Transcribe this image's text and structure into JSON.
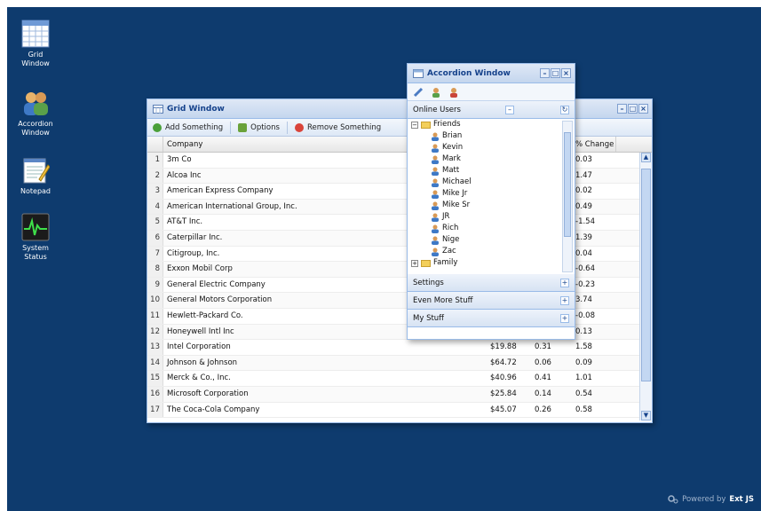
{
  "desktop_icons": [
    {
      "label_line1": "Grid",
      "label_line2": "Window",
      "icon": "grid-icon"
    },
    {
      "label_line1": "Accordion",
      "label_line2": "Window",
      "icon": "accordion-users-icon"
    },
    {
      "label_line1": "Notepad",
      "label_line2": "",
      "icon": "notepad-icon"
    },
    {
      "label_line1": "System",
      "label_line2": "Status",
      "icon": "system-status-icon"
    }
  ],
  "grid_window": {
    "title": "Grid Window",
    "toolbar": {
      "add": "Add Something",
      "options": "Options",
      "remove": "Remove Something"
    },
    "columns": {
      "company": "Company",
      "pct": "% Change"
    },
    "rows": [
      {
        "n": "1",
        "company": "3m Co",
        "price": "",
        "change": "",
        "pct": "0.03"
      },
      {
        "n": "2",
        "company": "Alcoa Inc",
        "price": "",
        "change": "",
        "pct": "1.47"
      },
      {
        "n": "3",
        "company": "American Express Company",
        "price": "",
        "change": "",
        "pct": "0.02"
      },
      {
        "n": "4",
        "company": "American International Group, Inc.",
        "price": "",
        "change": "",
        "pct": "0.49"
      },
      {
        "n": "5",
        "company": "AT&T Inc.",
        "price": "",
        "change": "",
        "pct": "-1.54"
      },
      {
        "n": "6",
        "company": "Caterpillar Inc.",
        "price": "",
        "change": "",
        "pct": "1.39"
      },
      {
        "n": "7",
        "company": "Citigroup, Inc.",
        "price": "",
        "change": "",
        "pct": "0.04"
      },
      {
        "n": "8",
        "company": "Exxon Mobil Corp",
        "price": "",
        "change": "",
        "pct": "-0.64"
      },
      {
        "n": "9",
        "company": "General Electric Company",
        "price": "",
        "change": "",
        "pct": "-0.23"
      },
      {
        "n": "10",
        "company": "General Motors Corporation",
        "price": "",
        "change": "",
        "pct": "3.74"
      },
      {
        "n": "11",
        "company": "Hewlett-Packard Co.",
        "price": "",
        "change": "",
        "pct": "-0.08"
      },
      {
        "n": "12",
        "company": "Honeywell Intl Inc",
        "price": "",
        "change": "",
        "pct": "0.13"
      },
      {
        "n": "13",
        "company": "Intel Corporation",
        "price": "$19.88",
        "change": "0.31",
        "pct": "1.58"
      },
      {
        "n": "14",
        "company": "Johnson & Johnson",
        "price": "$64.72",
        "change": "0.06",
        "pct": "0.09"
      },
      {
        "n": "15",
        "company": "Merck & Co., Inc.",
        "price": "$40.96",
        "change": "0.41",
        "pct": "1.01"
      },
      {
        "n": "16",
        "company": "Microsoft Corporation",
        "price": "$25.84",
        "change": "0.14",
        "pct": "0.54"
      },
      {
        "n": "17",
        "company": "The Coca-Cola Company",
        "price": "$45.07",
        "change": "0.26",
        "pct": "0.58"
      }
    ]
  },
  "accordion_window": {
    "title": "Accordion Window",
    "online_users_header": "Online Users",
    "friends_folder": "Friends",
    "friends": [
      "Brian",
      "Kevin",
      "Mark",
      "Matt",
      "Michael",
      "Mike Jr",
      "Mike Sr",
      "JR",
      "Rich",
      "Nige",
      "Zac"
    ],
    "family_folder": "Family",
    "panels": [
      "Settings",
      "Even More Stuff",
      "My Stuff"
    ]
  },
  "footer": {
    "powered_prefix": "Powered by",
    "brand": "Ext JS"
  },
  "colors": {
    "desktop": "#0e3b6e",
    "accent": "#15428b",
    "border": "#99bbe8"
  }
}
